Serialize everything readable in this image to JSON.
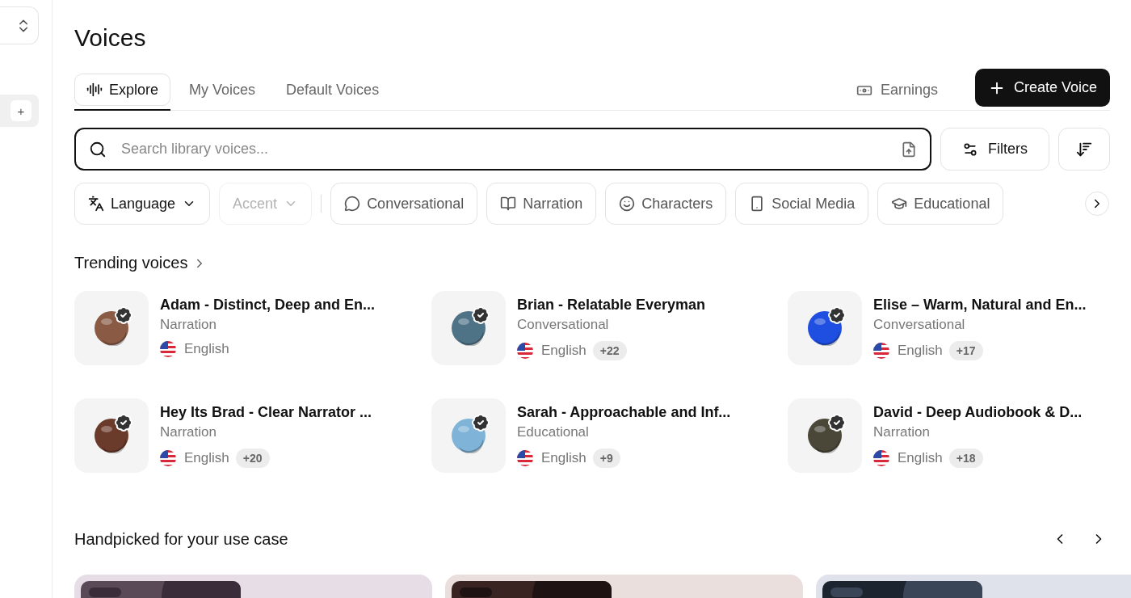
{
  "sidebar": {
    "items": [
      {
        "kind": "switcher"
      },
      {
        "kind": "add",
        "label": "+",
        "selected": true
      }
    ]
  },
  "page": {
    "title": "Voices"
  },
  "tabs": [
    {
      "label": "Explore",
      "selected": true
    },
    {
      "label": "My Voices",
      "selected": false
    },
    {
      "label": "Default Voices",
      "selected": false
    }
  ],
  "header_actions": {
    "earnings": "Earnings",
    "create": "Create Voice"
  },
  "search": {
    "placeholder": "Search library voices...",
    "filters": "Filters"
  },
  "chips": [
    {
      "kind": "dropdown",
      "label": "Language",
      "disabled": false
    },
    {
      "kind": "dropdown",
      "label": "Accent",
      "disabled": true
    },
    {
      "kind": "category",
      "label": "Conversational",
      "disabled": false
    },
    {
      "kind": "category",
      "label": "Narration",
      "disabled": false
    },
    {
      "kind": "category",
      "label": "Characters",
      "disabled": false
    },
    {
      "kind": "category",
      "label": "Social Media",
      "disabled": false
    },
    {
      "kind": "category",
      "label": "Educational",
      "disabled": false
    }
  ],
  "trending": {
    "title": "Trending voices",
    "voices": [
      {
        "name": "Adam - Distinct, Deep and En...",
        "category": "Narration",
        "language": "English",
        "color": "#8a5a44"
      },
      {
        "name": "Brian - Relatable Everyman",
        "category": "Conversational",
        "language": "English",
        "extra": "+22",
        "color": "#4f7386"
      },
      {
        "name": "Elise – Warm, Natural and En...",
        "category": "Conversational",
        "language": "English",
        "extra": "+17",
        "color": "#1f4fe0"
      },
      {
        "name": "Hey Its Brad - Clear Narrator ...",
        "category": "Narration",
        "language": "English",
        "extra": "+20",
        "color": "#6a3a2a"
      },
      {
        "name": "Sarah - Approachable and Inf...",
        "category": "Educational",
        "language": "English",
        "extra": "+9",
        "color": "#7fb4d8"
      },
      {
        "name": "David - Deep Audiobook & D...",
        "category": "Narration",
        "language": "English",
        "extra": "+18",
        "color": "#4a4638"
      }
    ]
  },
  "handpicked": {
    "title": "Handpicked for your use case"
  }
}
